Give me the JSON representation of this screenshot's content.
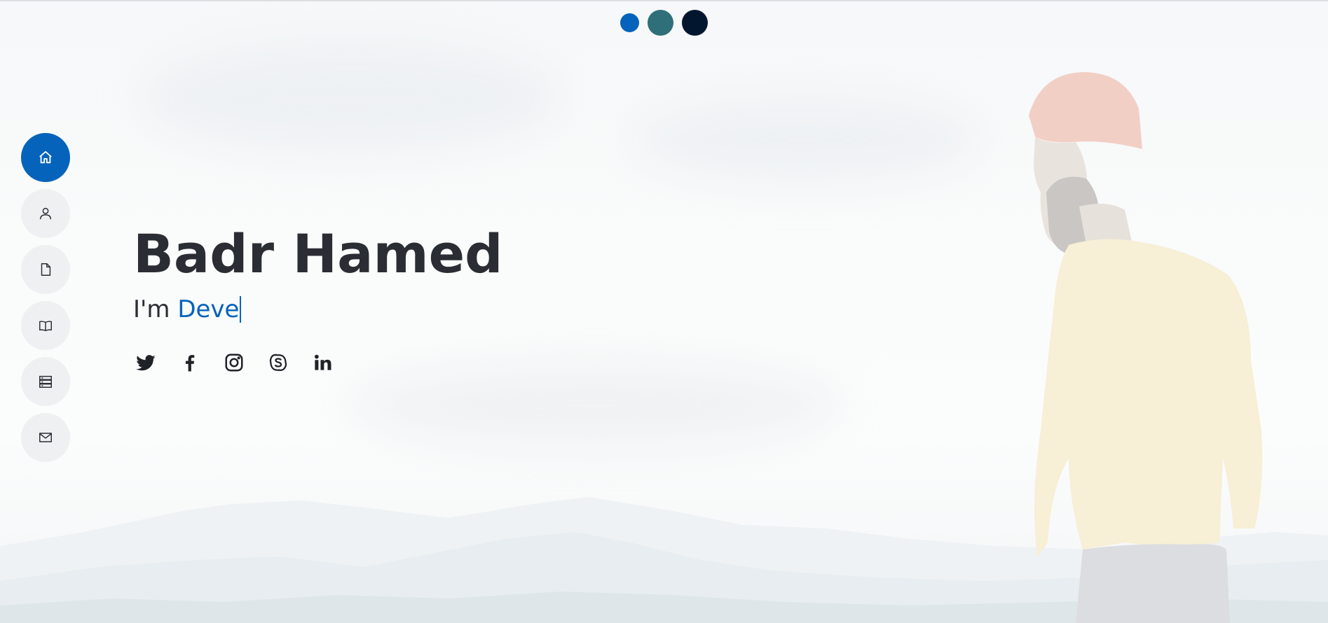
{
  "theme_dots": [
    {
      "name": "theme-blue",
      "color": "#0563bb"
    },
    {
      "name": "theme-teal",
      "color": "#2e6f7a"
    },
    {
      "name": "theme-navy",
      "color": "#02172f"
    }
  ],
  "nav": {
    "items": [
      {
        "icon": "home-icon",
        "active": true
      },
      {
        "icon": "user-icon",
        "active": false
      },
      {
        "icon": "file-icon",
        "active": false
      },
      {
        "icon": "book-icon",
        "active": false
      },
      {
        "icon": "server-icon",
        "active": false
      },
      {
        "icon": "envelope-icon",
        "active": false
      }
    ]
  },
  "hero": {
    "name": "Badr Hamed",
    "tagline_prefix": "I'm ",
    "typed_text": "Deve"
  },
  "socials": [
    {
      "icon": "twitter-icon"
    },
    {
      "icon": "facebook-icon"
    },
    {
      "icon": "instagram-icon"
    },
    {
      "icon": "skype-icon"
    },
    {
      "icon": "linkedin-icon"
    }
  ],
  "colors": {
    "accent": "#0563bb",
    "text": "#2a2d33",
    "nav_bg": "#eef0f2"
  }
}
